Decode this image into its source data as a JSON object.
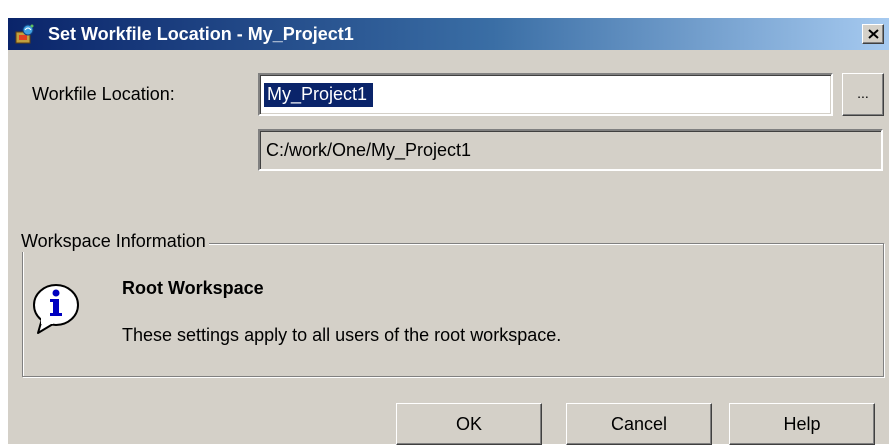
{
  "window": {
    "title": "Set Workfile Location - My_Project1",
    "app_icon": "project-app-icon",
    "close_glyph": "close-icon"
  },
  "form": {
    "workfile_location_label": "Workfile Location:",
    "workfile_location_value": "My_Project1",
    "browse_label": "...",
    "resolved_path": "C:/work/One/My_Project1"
  },
  "workspace_info": {
    "group_label": "Workspace Information",
    "icon": "info-icon",
    "title": "Root Workspace",
    "description": "These settings apply to all users of the root workspace."
  },
  "buttons": {
    "ok": "OK",
    "cancel": "Cancel",
    "help": "Help"
  },
  "colors": {
    "title_gradient_start": "#0a246a",
    "title_gradient_end": "#a6caf0",
    "dialog_face": "#d4d0c8",
    "selection": "#0a246a"
  }
}
